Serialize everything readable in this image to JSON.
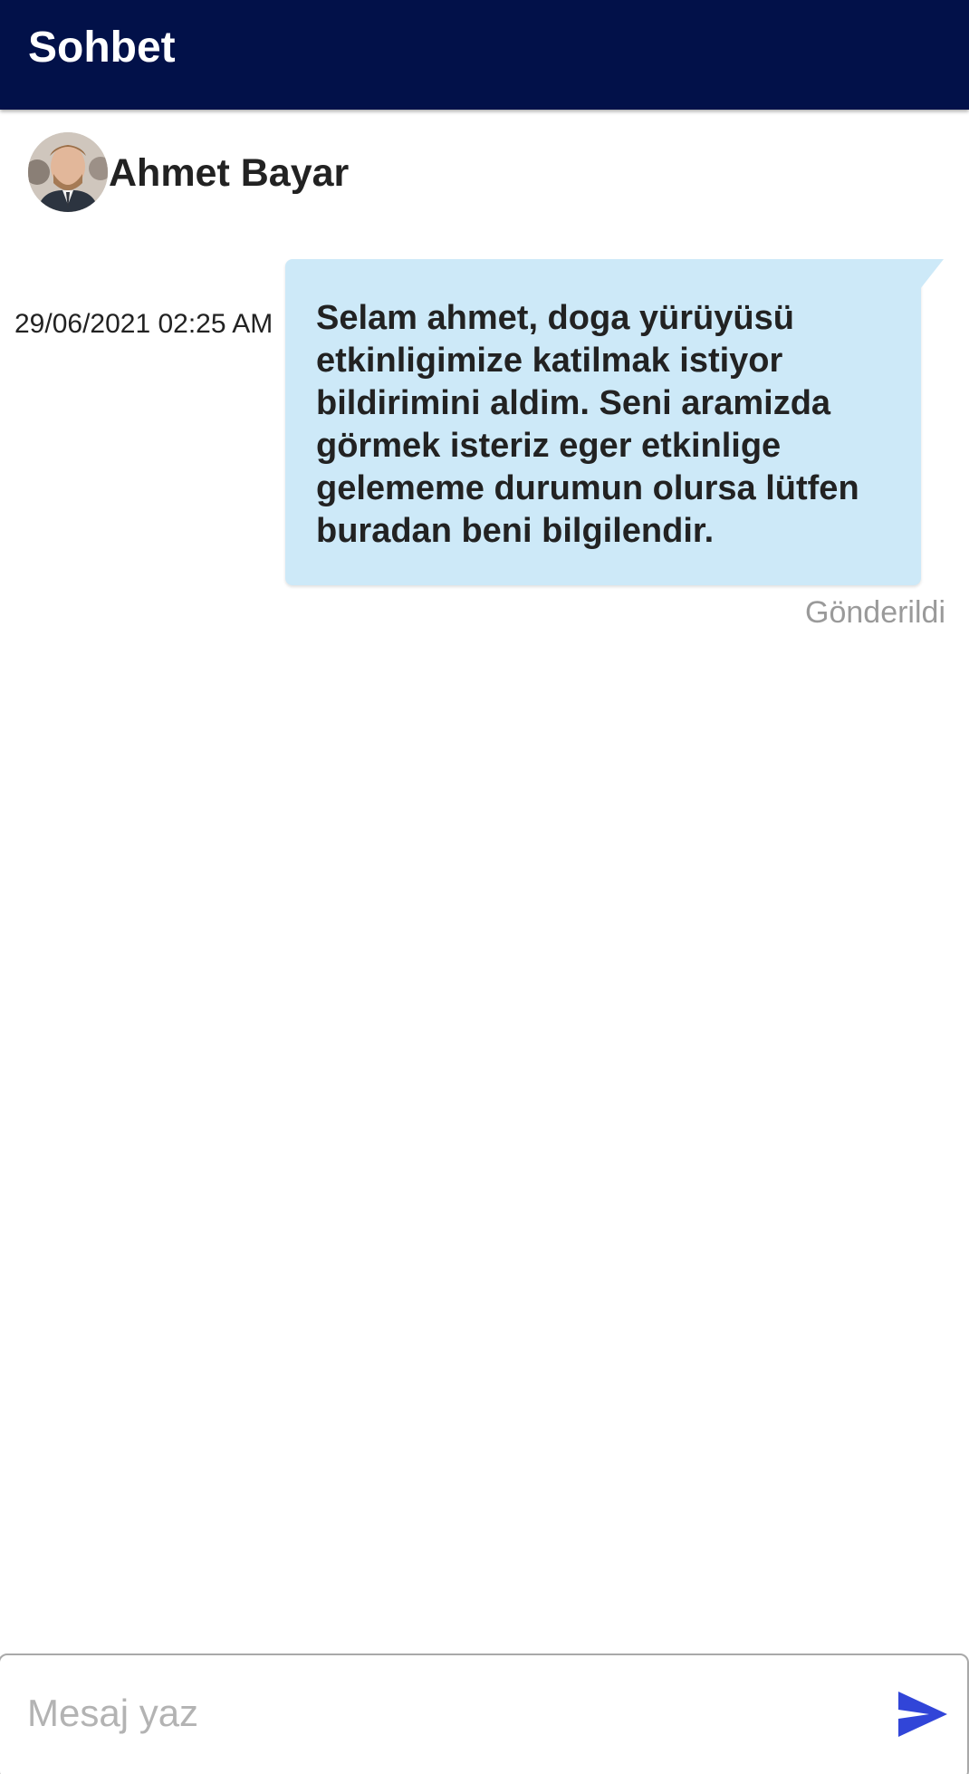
{
  "appbar": {
    "title": "Sohbet",
    "color": "#021149"
  },
  "contact": {
    "name": "Ahmet Bayar",
    "avatar_icon": "avatar-photo"
  },
  "messages": [
    {
      "timestamp": "29/06/2021 02:25 AM",
      "text": "Selam ahmet, doga yürüyüsü etkinligimize katilmak istiyor bildirimini aldim. Seni aramizda görmek isteriz eger etkinlige gelememe durumun olursa lütfen buradan beni bilgilendir.",
      "status": "Gönderildi",
      "bubble_color": "#cde9f8"
    }
  ],
  "composer": {
    "placeholder": "Mesaj yaz",
    "value": "",
    "send_icon": "send-icon",
    "send_color": "#3145d8"
  }
}
